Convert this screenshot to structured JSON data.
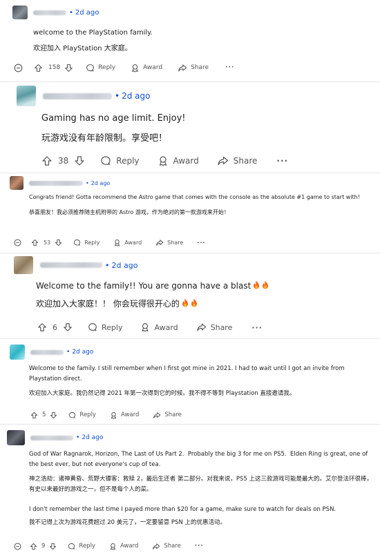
{
  "actions": {
    "reply_label": "Reply",
    "award_label": "Award",
    "share_label": "Share",
    "more_label": "···"
  },
  "comments": [
    {
      "time": "2d ago",
      "lines": [
        "welcome to the PlayStation family.",
        "欢迎加入 PlayStation 大家庭。"
      ],
      "votes": "158"
    },
    {
      "time": "2d ago",
      "lines": [
        "Gaming has no age limit. Enjoy!",
        "玩游戏没有年龄限制。享受吧！"
      ],
      "votes": "38"
    },
    {
      "time": "2d ago",
      "lines": [
        "Congrats friend! Gotta recommend the Astro game that comes with the console as the absolute #1 game to start with!",
        "恭喜朋友！我必须推荐随主机附带的 Astro 游戏，作为绝对的第一款游戏来开始！"
      ],
      "votes": "53"
    },
    {
      "time": "2d ago",
      "lines": [
        "Welcome to the family!! You are gonna have a blast",
        "欢迎加入大家庭！！ 你会玩得很开心的"
      ],
      "votes": "6"
    },
    {
      "time": "2d ago",
      "lines": [
        "Welcome to the family. I still remember when I first got mine in 2021. I had to wait until I got an invite from Playstation direct.",
        "欢迎加入大家庭。我仍然记得 2021 年第一次得到它的时候。我不得不等到 Playstation 直接邀请我。"
      ],
      "votes": "5"
    },
    {
      "time": "2d ago",
      "lines": [
        "God of War Ragnarok, Horizon, The Last of Us Part 2.  Probably the big 3 for me on PS5.  Elden Ring is great, one of the best ever, but not everyone's cup of tea.",
        "神之浩劫：诸神黄昏、荒野大镖客：救赎 2，最后生还者 第二部分。对我来说，PS5 上这三款游戏可能是最大的。艾尔登法环很棒，有史以来最好的游戏之一，但不是每个人的菜。",
        "I don't remember the last time I payed more than $20 for a game, make sure to watch for deals on PSN.",
        "我不记得上次为游戏花费超过 20 美元了，一定要留意 PSN 上的优惠活动。"
      ],
      "votes": "9"
    }
  ]
}
